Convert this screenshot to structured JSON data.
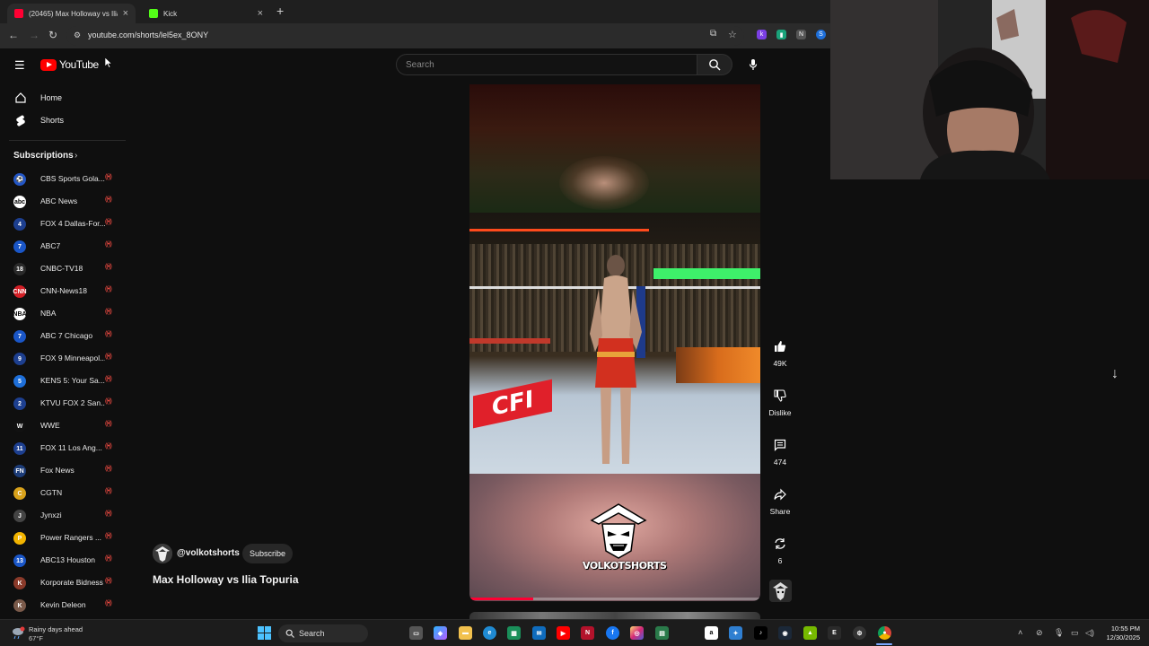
{
  "browser": {
    "tabs": [
      {
        "title": "(20465) Max Holloway vs Ilia...",
        "favicon_color": "#ff0033",
        "active": true
      },
      {
        "title": "Kick",
        "favicon_color": "#53fc18",
        "active": false
      }
    ],
    "url": "youtube.com/shorts/lel5ex_8ONY"
  },
  "youtube": {
    "logo_text": "YouTube",
    "search_placeholder": "Search",
    "nav": [
      {
        "label": "Home",
        "icon": "home-icon"
      },
      {
        "label": "Shorts",
        "icon": "shorts-icon"
      }
    ],
    "subscriptions_header": "Subscriptions",
    "subscriptions": [
      {
        "name": "CBS Sports Gola...",
        "color": "#2356c4",
        "glyph": "⚽"
      },
      {
        "name": "ABC News",
        "color": "#ffffff",
        "glyph": "abc"
      },
      {
        "name": "FOX 4 Dallas-For...",
        "color": "#1d3f8f",
        "glyph": "4"
      },
      {
        "name": "ABC7",
        "color": "#1a56c7",
        "glyph": "7"
      },
      {
        "name": "CNBC-TV18",
        "color": "#2a2a2a",
        "glyph": "18"
      },
      {
        "name": "CNN-News18",
        "color": "#d31f26",
        "glyph": "CNN"
      },
      {
        "name": "NBA",
        "color": "#ffffff",
        "glyph": "NBA"
      },
      {
        "name": "ABC 7 Chicago",
        "color": "#1a56c7",
        "glyph": "7"
      },
      {
        "name": "FOX 9 Minneapol...",
        "color": "#1d3f8f",
        "glyph": "9"
      },
      {
        "name": "KENS 5: Your Sa...",
        "color": "#1e6fd9",
        "glyph": "5"
      },
      {
        "name": "KTVU FOX 2 San...",
        "color": "#1d3f8f",
        "glyph": "2"
      },
      {
        "name": "WWE",
        "color": "#111111",
        "glyph": "W"
      },
      {
        "name": "FOX 11 Los Ang...",
        "color": "#1d3f8f",
        "glyph": "11"
      },
      {
        "name": "Fox News",
        "color": "#1c3c78",
        "glyph": "FN"
      },
      {
        "name": "CGTN",
        "color": "#d9a21b",
        "glyph": "C"
      },
      {
        "name": "Jynxzi",
        "color": "#444444",
        "glyph": "J"
      },
      {
        "name": "Power Rangers ...",
        "color": "#f2b400",
        "glyph": "P"
      },
      {
        "name": "ABC13 Houston",
        "color": "#1a56c7",
        "glyph": "13"
      },
      {
        "name": "Korporate Bidness",
        "color": "#8a3a2a",
        "glyph": "K"
      },
      {
        "name": "Kevin Deleon",
        "color": "#7a5a4a",
        "glyph": "K"
      }
    ],
    "live_indicator": "((•))",
    "short": {
      "channel_handle": "@volkotshorts",
      "subscribe_label": "Subscribe",
      "title": "Max Holloway vs Ilia Topuria",
      "watermark": "VOLKOTSHORTS",
      "ring_logo": "CFI",
      "progress": 0.22
    },
    "actions": {
      "likes": "49K",
      "dislike_label": "Dislike",
      "comments": "474",
      "share_label": "Share",
      "remix": "6"
    }
  },
  "taskbar": {
    "weather_line1": "Rainy days ahead",
    "weather_line2": "67°F",
    "search_label": "Search",
    "time": "10:55 PM",
    "date": "12/30/2025"
  }
}
